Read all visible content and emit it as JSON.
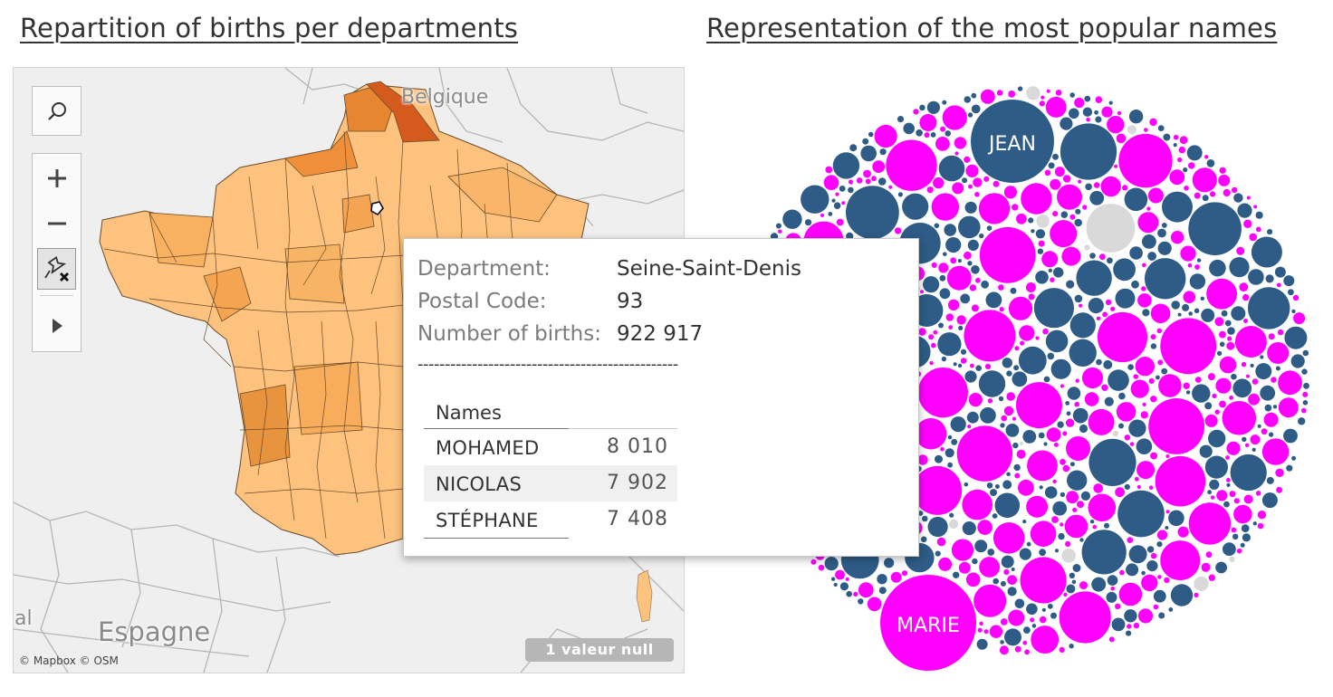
{
  "left_title": "Repartition of births per departments",
  "right_title": "Representation of the most popular names",
  "map": {
    "labels": {
      "belgique": "Belgique",
      "espagne": "Espagne",
      "partial": "al"
    },
    "attribution": "© Mapbox © OSM",
    "null_badge": "1 valeur null",
    "colors": {
      "low": "#fdc27e",
      "mid": "#f5a451",
      "high": "#e68631",
      "max": "#d45a1e",
      "border": "#6a4a2a",
      "background": "#efefef"
    }
  },
  "map_tools": [
    {
      "name": "search-button",
      "icon": "search-icon"
    },
    {
      "name": "zoom-in-button",
      "icon": "plus-icon"
    },
    {
      "name": "zoom-out-button",
      "icon": "minus-icon"
    },
    {
      "name": "unpin-button",
      "icon": "unpin-icon"
    },
    {
      "name": "expand-toolbar-button",
      "icon": "play-icon"
    }
  ],
  "tooltip": {
    "rows": [
      {
        "label": "Department:",
        "value": "Seine-Saint-Denis"
      },
      {
        "label": "Postal Code:",
        "value": "93"
      },
      {
        "label": "Number of births:",
        "value": "922 917"
      }
    ],
    "separator": "------------------------------------------------",
    "names_header": "Names",
    "names": [
      {
        "name": "MOHAMED",
        "count": "8 010"
      },
      {
        "name": "NICOLAS",
        "count": "7 902"
      },
      {
        "name": "STÉPHANE",
        "count": "7 408"
      }
    ]
  },
  "bubbles": {
    "labels": {
      "jean": "JEAN",
      "marie": "MARIE"
    },
    "colors": {
      "male": "#2e5c87",
      "female": "#ff00ff",
      "unknown": "#d9d9d9",
      "text": "#ffffff"
    }
  }
}
